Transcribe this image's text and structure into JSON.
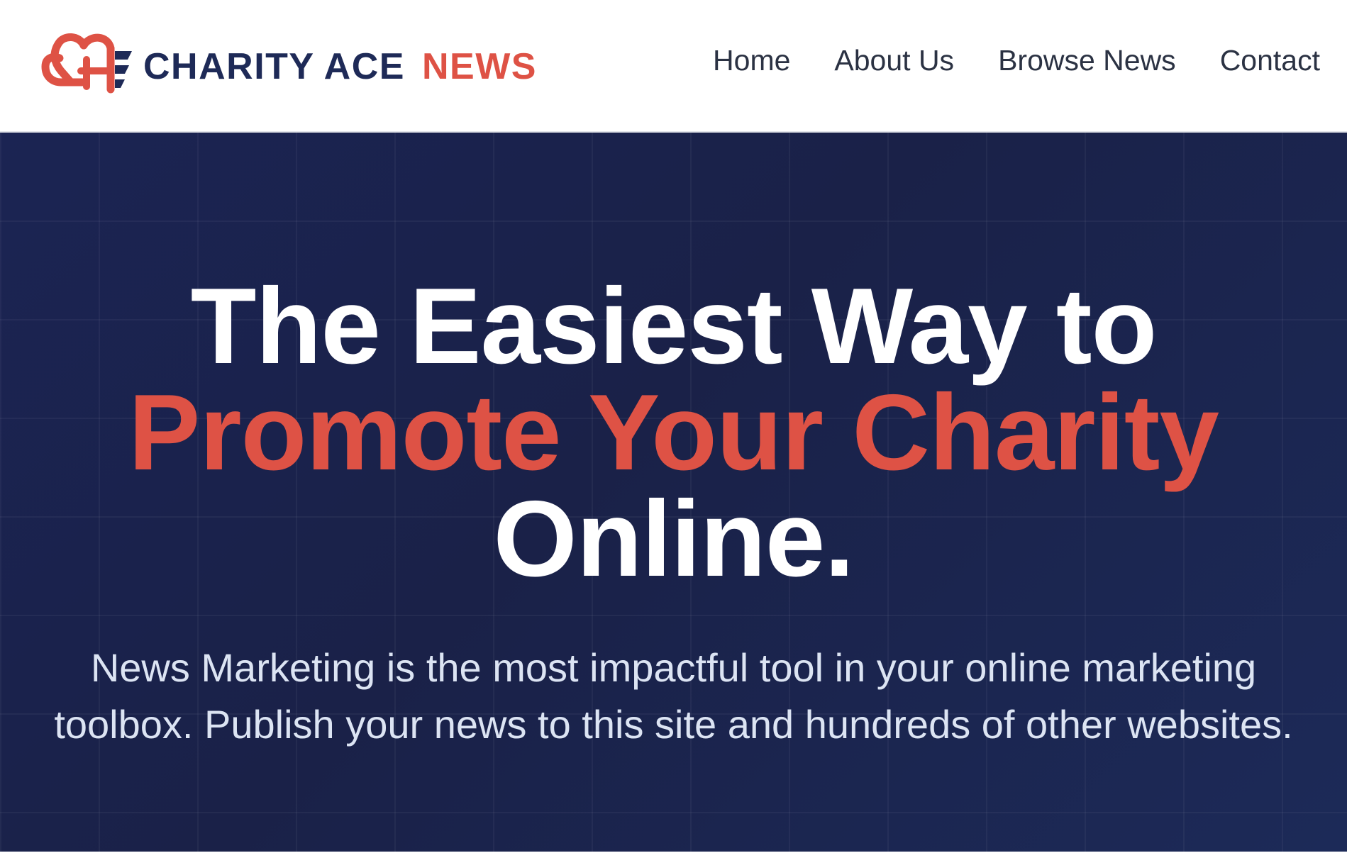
{
  "header": {
    "logo": {
      "brand_text": "CHARITY ACE",
      "accent_text": "NEWS",
      "icon": "heart-af-monogram-icon"
    },
    "nav": [
      {
        "label": "Home"
      },
      {
        "label": "About Us"
      },
      {
        "label": "Browse News"
      },
      {
        "label": "Contact"
      }
    ]
  },
  "hero": {
    "title_line_1": "The Easiest Way to",
    "title_line_2": "Promote Your Charity",
    "title_line_3": "Online.",
    "subtitle": "News Marketing is the most impactful tool in your online marketing toolbox. Publish your news to this site and hundreds of other websites."
  },
  "colors": {
    "navy": "#1e2a57",
    "accent_red": "#de5245",
    "hero_background": "#1b2453",
    "nav_text": "#2b3243",
    "subtitle_text": "#dce4f3"
  }
}
